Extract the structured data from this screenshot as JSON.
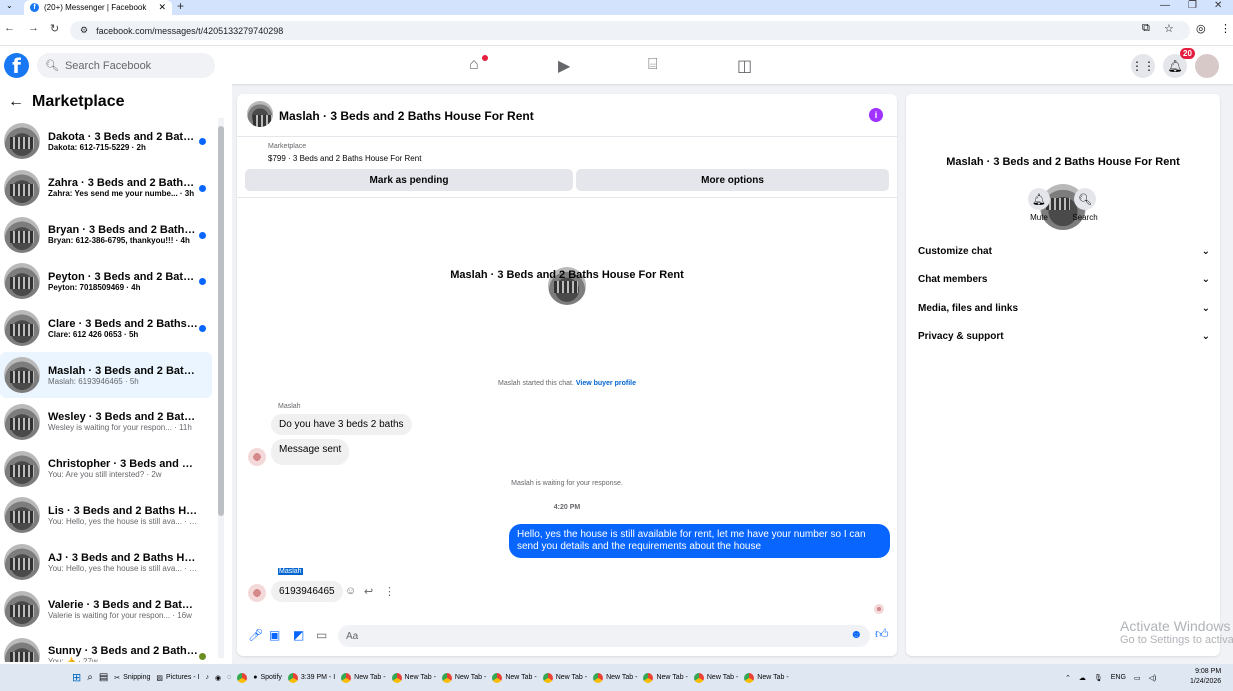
{
  "browser": {
    "tab_title": "(20+) Messenger | Facebook",
    "url": "facebook.com/messages/t/4205133279740298"
  },
  "fb": {
    "search_placeholder": "Search Facebook",
    "notif_count": "20"
  },
  "sidebar": {
    "title": "Marketplace",
    "conversations": [
      {
        "title": "Dakota · 3 Beds and 2 Baths H...",
        "sub": "Dakota: 612-715-5229 · 2h",
        "unread": true
      },
      {
        "title": "Zahra · 3 Beds and 2 Baths Ho...",
        "sub": "Zahra: Yes send me your numbe... · 3h",
        "unread": true
      },
      {
        "title": "Bryan · 3 Beds and 2 Baths Ho...",
        "sub": "Bryan: 612-386-6795, thankyou!!! · 4h",
        "unread": true
      },
      {
        "title": "Peyton · 3 Beds and 2 Baths H...",
        "sub": "Peyton: 7018509469 · 4h",
        "unread": true
      },
      {
        "title": "Clare · 3 Beds and 2 Baths Hou...",
        "sub": "Clare: 612 426 0653 · 5h",
        "unread": true
      },
      {
        "title": "Maslah · 3 Beds and 2 Baths Ho...",
        "sub": "Maslah: 6193946465 · 5h",
        "unread": false
      },
      {
        "title": "Wesley · 3 Beds and 2 Baths Ho...",
        "sub": "Wesley is waiting for your respon... · 11h",
        "unread": false
      },
      {
        "title": "Christopher · 3 Beds and 2 Baths...",
        "sub": "You: Are you still intersted? · 2w",
        "unread": false
      },
      {
        "title": "Lis · 3 Beds and 2 Baths House F...",
        "sub": "You: Hello, yes the house is still ava... · 2w",
        "unread": false
      },
      {
        "title": "AJ · 3 Beds and 2 Baths House F...",
        "sub": "You: Hello, yes the house is still ava... · 2w",
        "unread": false
      },
      {
        "title": "Valerie · 3 Beds and 2 Baths Hou...",
        "sub": "Valerie is waiting for your respon... · 16w",
        "unread": false
      },
      {
        "title": "Sunny · 3 Beds and 2 Baths H...",
        "sub": "You: 👍 · 27w",
        "unread": false
      }
    ]
  },
  "chat": {
    "title": "Maslah · 3 Beds and 2 Baths House For Rent",
    "marketplace_label": "Marketplace",
    "listing": "$799 · 3 Beds and 2 Baths House For Rent",
    "mark_pending": "Mark as pending",
    "more_options": "More options",
    "started_text": "Maslah started this chat.",
    "view_profile": "View buyer profile",
    "sender": "Maslah",
    "msg1": "Do you have 3 beds 2 baths",
    "msg2": "Message sent",
    "waiting": "Maslah is waiting for your response.",
    "time": "4:20 PM",
    "outgoing": "Hello, yes the house is still available for rent, let me have your number so I can send you details and the requirements about the house",
    "msg3": "6193946465",
    "composer_placeholder": "Aa"
  },
  "rpanel": {
    "name": "Maslah · 3 Beds and 2 Baths House For Rent",
    "mute": "Mute",
    "search": "Search",
    "sections": [
      "Customize chat",
      "Chat members",
      "Media, files and links",
      "Privacy & support"
    ]
  },
  "watermark": {
    "line1": "Activate Windows",
    "line2": "Go to Settings to activate Windows."
  },
  "taskbar": {
    "items": [
      "Snipping",
      "Pictures - I",
      "3:39 PM - I",
      "New Tab -",
      "New Tab -",
      "New Tab -",
      "New Tab -",
      "New Tab -",
      "New Tab -",
      "New Tab -",
      "New Tab -",
      "New Tab -"
    ],
    "spotify": "Spotify",
    "lang": "ENG",
    "time": "9:08 PM",
    "date": "1/24/2026"
  }
}
